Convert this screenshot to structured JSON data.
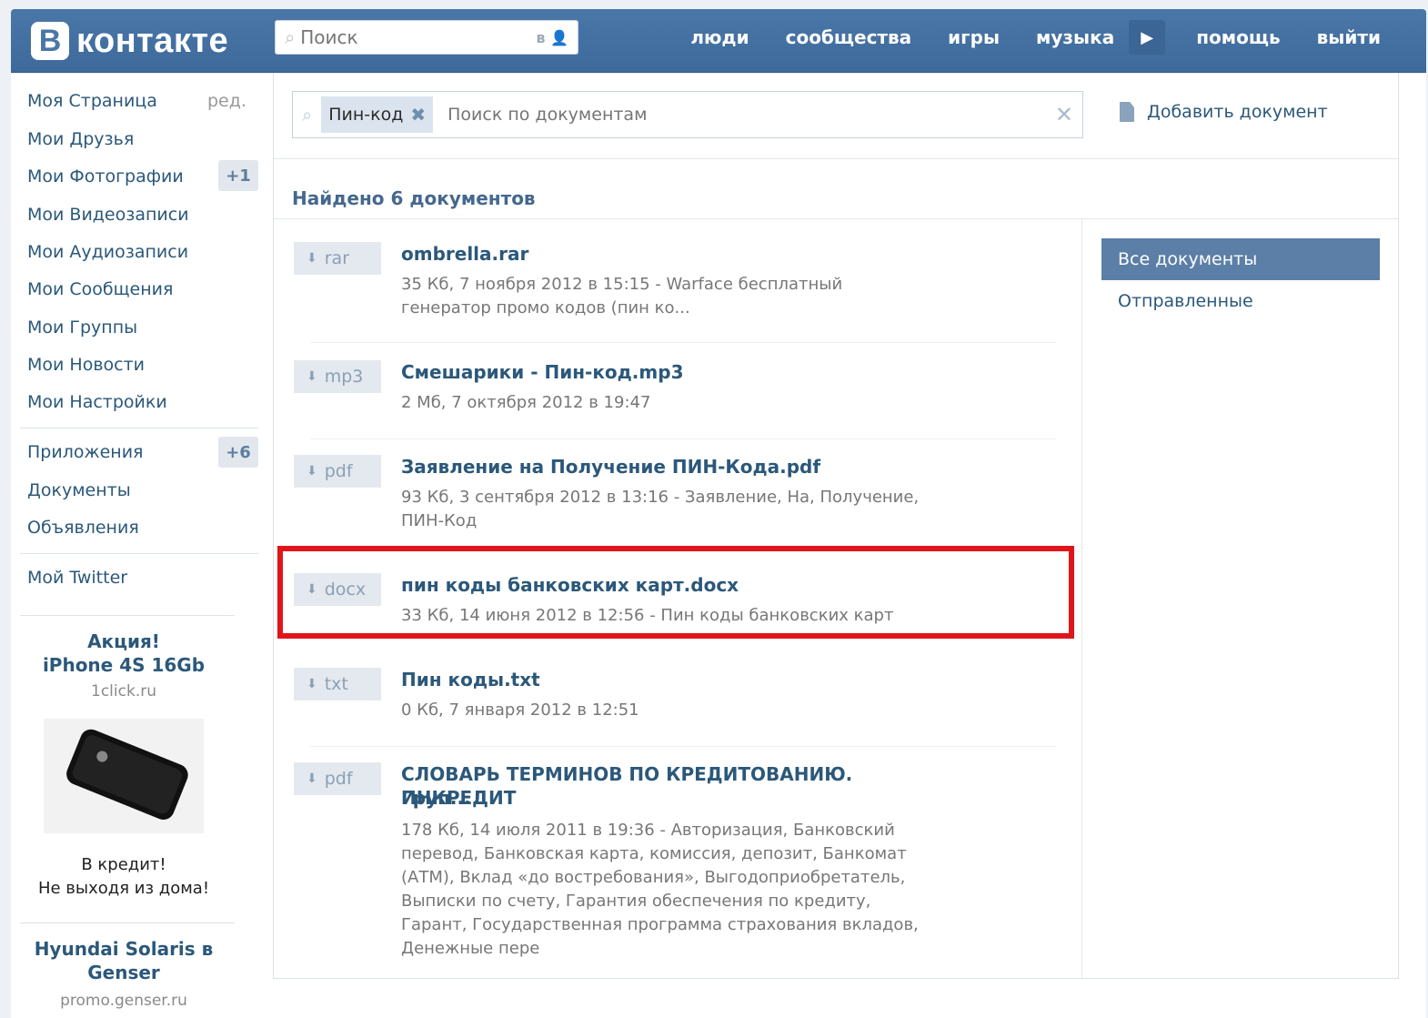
{
  "header": {
    "logo_letter": "В",
    "logo_text": "контакте",
    "search_placeholder": "Поиск",
    "search_scope": "в 👤",
    "nav": [
      "люди",
      "сообщества",
      "игры",
      "музыка",
      "помощь",
      "выйти"
    ]
  },
  "sidebar": {
    "items": [
      {
        "label": "Моя Страница",
        "extra": "ред."
      },
      {
        "label": "Мои Друзья"
      },
      {
        "label": "Мои Фотографии",
        "badge": "+1"
      },
      {
        "label": "Мои Видеозаписи"
      },
      {
        "label": "Мои Аудиозаписи"
      },
      {
        "label": "Мои Сообщения"
      },
      {
        "label": "Мои Группы"
      },
      {
        "label": "Мои Новости"
      },
      {
        "label": "Мои Настройки"
      },
      {
        "label": "Приложения",
        "badge": "+6"
      },
      {
        "label": "Документы"
      },
      {
        "label": "Объявления"
      },
      {
        "label": "Мой Twitter"
      }
    ],
    "ads": [
      {
        "title_line1": "Акция!",
        "title_line2": "iPhone 4S 16Gb",
        "domain": "1click.ru",
        "text_line1": "В кредит!",
        "text_line2": "Не выходя из дома!"
      },
      {
        "title_line1": "Hyundai Solaris в",
        "title_line2": "Genser",
        "domain": "promo.genser.ru"
      }
    ]
  },
  "docs_page": {
    "search_tag": "Пин-код",
    "search_placeholder": "Поиск по документам",
    "add_document": "Добавить документ",
    "found": "Найдено 6 документов",
    "filters": [
      "Все документы",
      "Отправленные"
    ],
    "documents": [
      {
        "ext": "rar",
        "title": "ombrella.rar",
        "meta": [
          "35 Кб, 7 ноября 2012 в 15:15 - Warface бесплатный",
          "генератор промо кодов (пин ко..."
        ]
      },
      {
        "ext": "mp3",
        "title": "Смешарики - Пин-код.mp3",
        "meta": [
          "2 Мб, 7 октября 2012 в 19:47"
        ]
      },
      {
        "ext": "pdf",
        "title": "Заявление на Получение ПИН-Кода.pdf",
        "meta": [
          "93 Кб, 3 сентября 2012 в 13:16 - Заявление, На, Получение,",
          "ПИН-Код"
        ]
      },
      {
        "ext": "docx",
        "title": "пин коды банковских карт.docx",
        "meta": [
          "33 Кб, 14 июня 2012 в 12:56 - Пин коды банковских карт"
        ]
      },
      {
        "ext": "txt",
        "title": "Пин коды.txt",
        "meta": [
          "0 Кб, 7 января 2012 в 12:51"
        ]
      },
      {
        "ext": "pdf",
        "title_line1": "СЛОВАРЬ ТЕРМИНОВ ПО КРЕДИТОВАНИЮ. ИНКРЕДИТ",
        "title_line2": "Груп...",
        "meta": [
          "178 Кб, 14 июля 2011 в 19:36 - Авторизация, Банковский",
          "перевод, Банковская карта, комиссия, депозит, Банкомат",
          "(АТМ), Вклад «до востребования», Выгодоприобретатель,",
          "Выписки по счету, Гарантия обеспечения по кредиту,",
          "Гарант, Государственная программа страхования вкладов,",
          "Денежные пере"
        ]
      }
    ]
  },
  "colors": {
    "header": "#4a77a8",
    "link": "#2b587a",
    "highlight": "#e0151b",
    "active_filter": "#5b7fa6"
  }
}
